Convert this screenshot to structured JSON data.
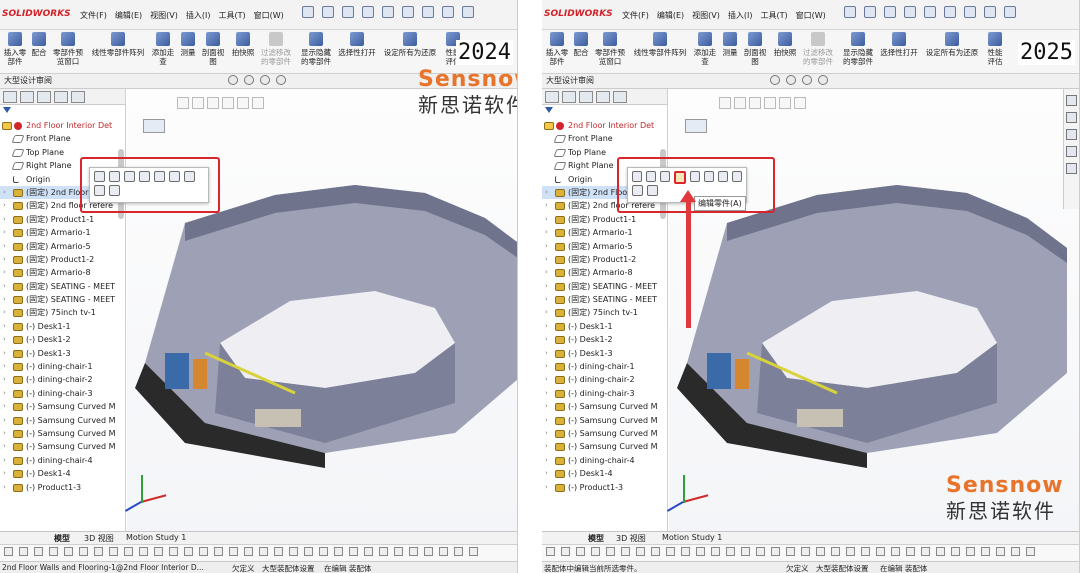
{
  "panels": [
    {
      "logo": "SOLIDWORKS",
      "menus": [
        "文件(F)",
        "编辑(E)",
        "视图(V)",
        "插入(I)",
        "工具(T)",
        "窗口(W)"
      ],
      "ribbon": [
        "插入零部件",
        "配合",
        "零部件预览窗口",
        "线性零部件阵列",
        "添加走查",
        "测量",
        "剖面视图",
        "拍快照",
        "过滤移改的零部件",
        "显示隐藏的零部件",
        "选择性打开",
        "设定所有为还原",
        "性能评估"
      ],
      "year": "2024",
      "tab": "大型设计审阅",
      "tree": {
        "root": "2nd Floor Interior Det",
        "items": [
          "Front Plane",
          "Top Plane",
          "Right Plane",
          "Origin",
          "(固定) 2nd Floor Walls",
          "(固定) 2nd floor refere",
          "(固定) Product1-1",
          "(固定) Armario-1",
          "(固定) Armario-5",
          "(固定) Product1-2",
          "(固定) Armario-8",
          "(固定) SEATING - MEET",
          "(固定) SEATING - MEET",
          "(固定) 75inch tv-1",
          "(-) Desk1-1",
          "(-) Desk1-2",
          "(-) Desk1-3",
          "(-) dining-chair-1",
          "(-) dining-chair-2",
          "(-) dining-chair-3",
          "(-) Samsung Curved M",
          "(-) Samsung Curved M",
          "(-) Samsung Curved M",
          "(-) Samsung Curved M",
          "(-) dining-chair-4",
          "(-) Desk1-4",
          "(-) Product1-3"
        ]
      },
      "bottom_tabs": [
        "模型",
        "3D 视图",
        "Motion Study 1"
      ],
      "status": [
        "2nd Floor Walls and Flooring-1@2nd Floor Interior D...",
        "欠定义",
        "大型装配体设置",
        "在编辑 装配体"
      ]
    },
    {
      "logo": "SOLIDWORKS",
      "menus": [
        "文件(F)",
        "编辑(E)",
        "视图(V)",
        "插入(I)",
        "工具(T)",
        "窗口(W)"
      ],
      "ribbon": [
        "插入零部件",
        "配合",
        "零部件预览窗口",
        "线性零部件阵列",
        "添加走查",
        "测量",
        "剖面视图",
        "拍快照",
        "过滤移改的零部件",
        "显示隐藏的零部件",
        "选择性打开",
        "设定所有为还原",
        "性能评估"
      ],
      "year": "2025",
      "tab": "大型设计审阅",
      "tree": {
        "root": "2nd Floor Interior Det",
        "items": [
          "Front Plane",
          "Top Plane",
          "Right Plane",
          "Origin",
          "(固定) 2nd Floor Walls",
          "(固定) 2nd floor refere",
          "(固定) Product1-1",
          "(固定) Armario-1",
          "(固定) Armario-5",
          "(固定) Product1-2",
          "(固定) Armario-8",
          "(固定) SEATING - MEET",
          "(固定) SEATING - MEET",
          "(固定) 75inch tv-1",
          "(-) Desk1-1",
          "(-) Desk1-2",
          "(-) Desk1-3",
          "(-) dining-chair-1",
          "(-) dining-chair-2",
          "(-) dining-chair-3",
          "(-) Samsung Curved M",
          "(-) Samsung Curved M",
          "(-) Samsung Curved M",
          "(-) Samsung Curved M",
          "(-) dining-chair-4",
          "(-) Desk1-4",
          "(-) Product1-3"
        ]
      },
      "tooltip": "编辑零件(A)",
      "bottom_tabs": [
        "模型",
        "3D 视图",
        "Motion Study 1"
      ],
      "status": [
        "装配体中编辑当前所选零件。",
        "欠定义",
        "大型装配体设置",
        "在编辑 装配体"
      ]
    }
  ],
  "brand": {
    "en": "Sensnow",
    "cn": "新思诺软件"
  },
  "colors": {
    "highlight_red": "#d8262c",
    "brand_orange": "#e8742c",
    "selected_row": "#cfe1f7"
  }
}
